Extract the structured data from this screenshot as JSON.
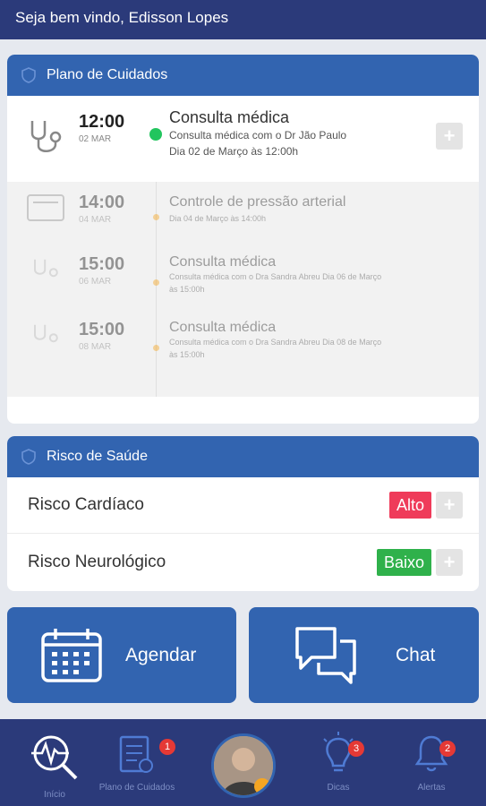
{
  "header": {
    "greeting": "Seja bem vindo, Edisson Lopes"
  },
  "plan": {
    "title": "Plano de Cuidados",
    "items": [
      {
        "time": "12:00",
        "date": "02 MAR",
        "title": "Consulta médica",
        "line1": "Consulta médica com o Dr Jão Paulo",
        "line2": "Dia 02 de Março às 12:00h",
        "status_color": "#22c55e"
      },
      {
        "time": "14:00",
        "date": "04 MAR",
        "title": "Controle de pressão arterial",
        "line1": "Dia 04 de Março às 14:00h",
        "line2": "",
        "status_color": "#f5a623"
      },
      {
        "time": "15:00",
        "date": "06 MAR",
        "title": "Consulta médica",
        "line1": "Consulta médica com o Dra Sandra Abreu Dia 06 de Março",
        "line2": "às 15:00h",
        "status_color": "#f5a623"
      },
      {
        "time": "15:00",
        "date": "08 MAR",
        "title": "Consulta médica",
        "line1": "Consulta médica com o Dra Sandra Abreu Dia 08 de Março",
        "line2": "às 15:00h",
        "status_color": "#f5a623"
      }
    ],
    "more_icon": "chevron-down-icon"
  },
  "risk": {
    "title": "Risco de Saúde",
    "items": [
      {
        "label": "Risco Cardíaco",
        "level": "Alto",
        "color": "#ef3b5a"
      },
      {
        "label": "Risco Neurológico",
        "level": "Baixo",
        "color": "#2fb14b"
      }
    ]
  },
  "actions": {
    "schedule": "Agendar",
    "chat": "Chat"
  },
  "nav": {
    "home": {
      "label": "Início"
    },
    "plan": {
      "label": "Plano de Cuidados",
      "badge": "1"
    },
    "tips": {
      "label": "Dicas",
      "badge": "3"
    },
    "alerts": {
      "label": "Alertas",
      "badge": "2"
    }
  },
  "colors": {
    "primary": "#3264b0",
    "navy": "#2b3a7a",
    "accent_green": "#22c55e"
  }
}
